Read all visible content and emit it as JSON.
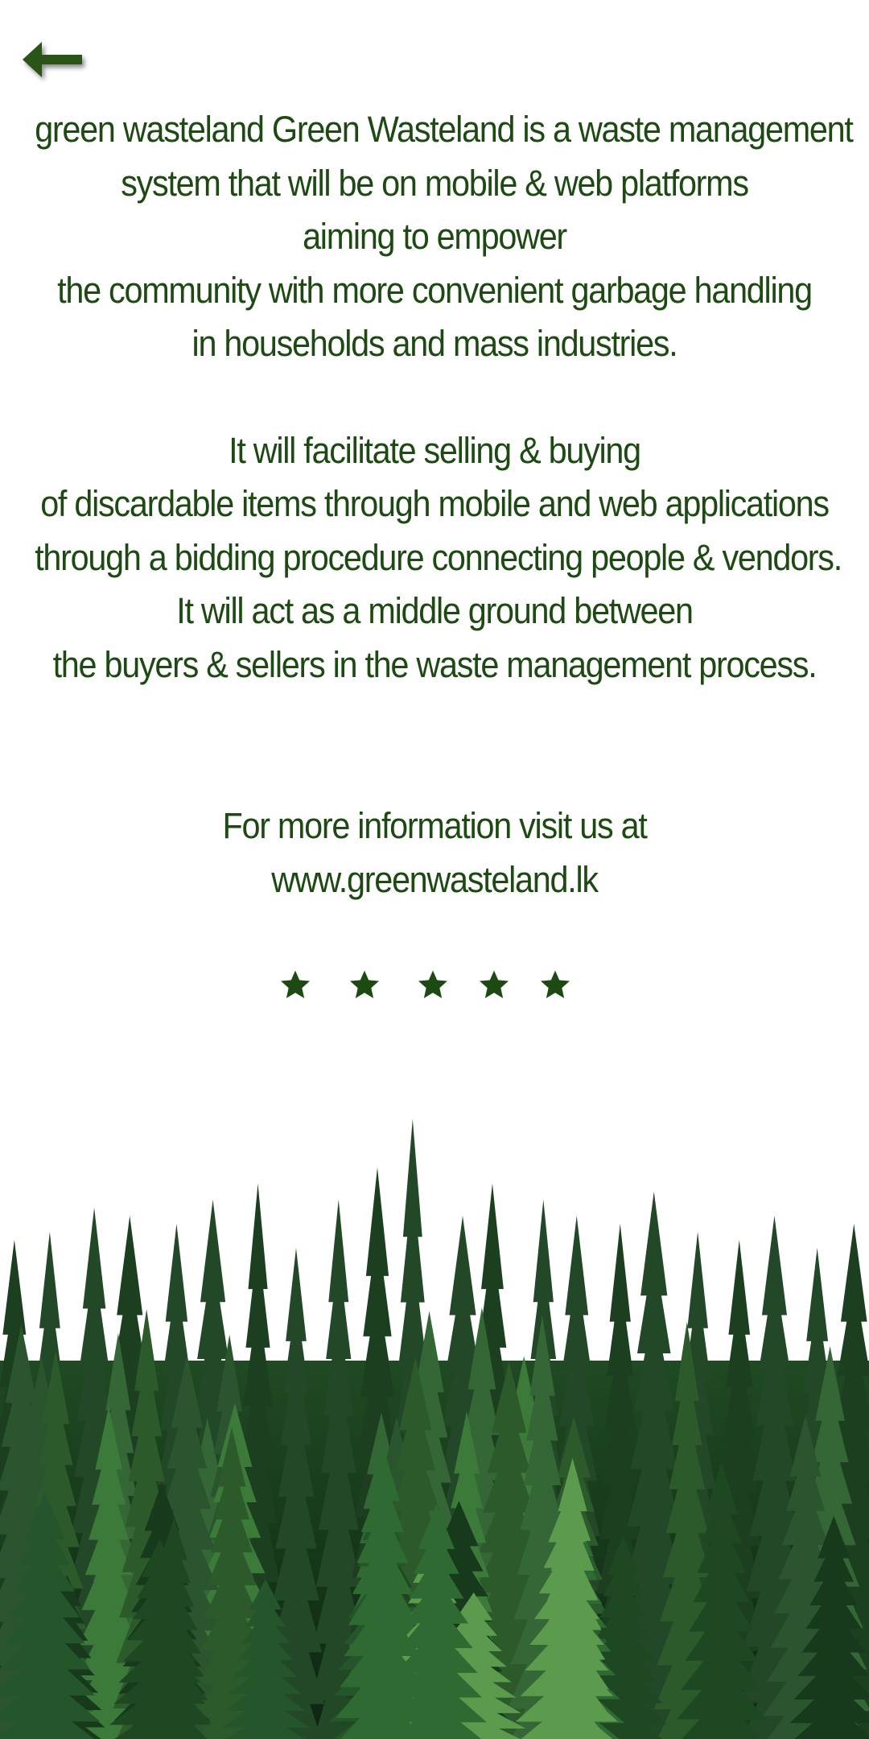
{
  "nav": {
    "back_icon": "arrow-left-icon"
  },
  "about": {
    "lines": [
      "green wasteland Green Wasteland is a waste management",
      "system that will be on mobile & web platforms",
      "aiming to empower",
      "the community with more convenient garbage handling",
      "in households and mass industries.",
      "It will facilitate selling & buying",
      "of discardable items through mobile and web applications",
      "through a bidding procedure connecting people & vendors.",
      "It will act as a middle ground between",
      "the buyers & sellers in the waste management process."
    ]
  },
  "contact": {
    "intro": "For more information visit us at",
    "website": "www.greenwasteland.lk"
  },
  "rating": {
    "icon": "star-icon",
    "value": 5,
    "max": 5
  },
  "colors": {
    "text": "#1d4a12",
    "background": "#ffffff",
    "star": "#1d4a12"
  },
  "background_image": {
    "subject": "forest-treeline-image"
  }
}
